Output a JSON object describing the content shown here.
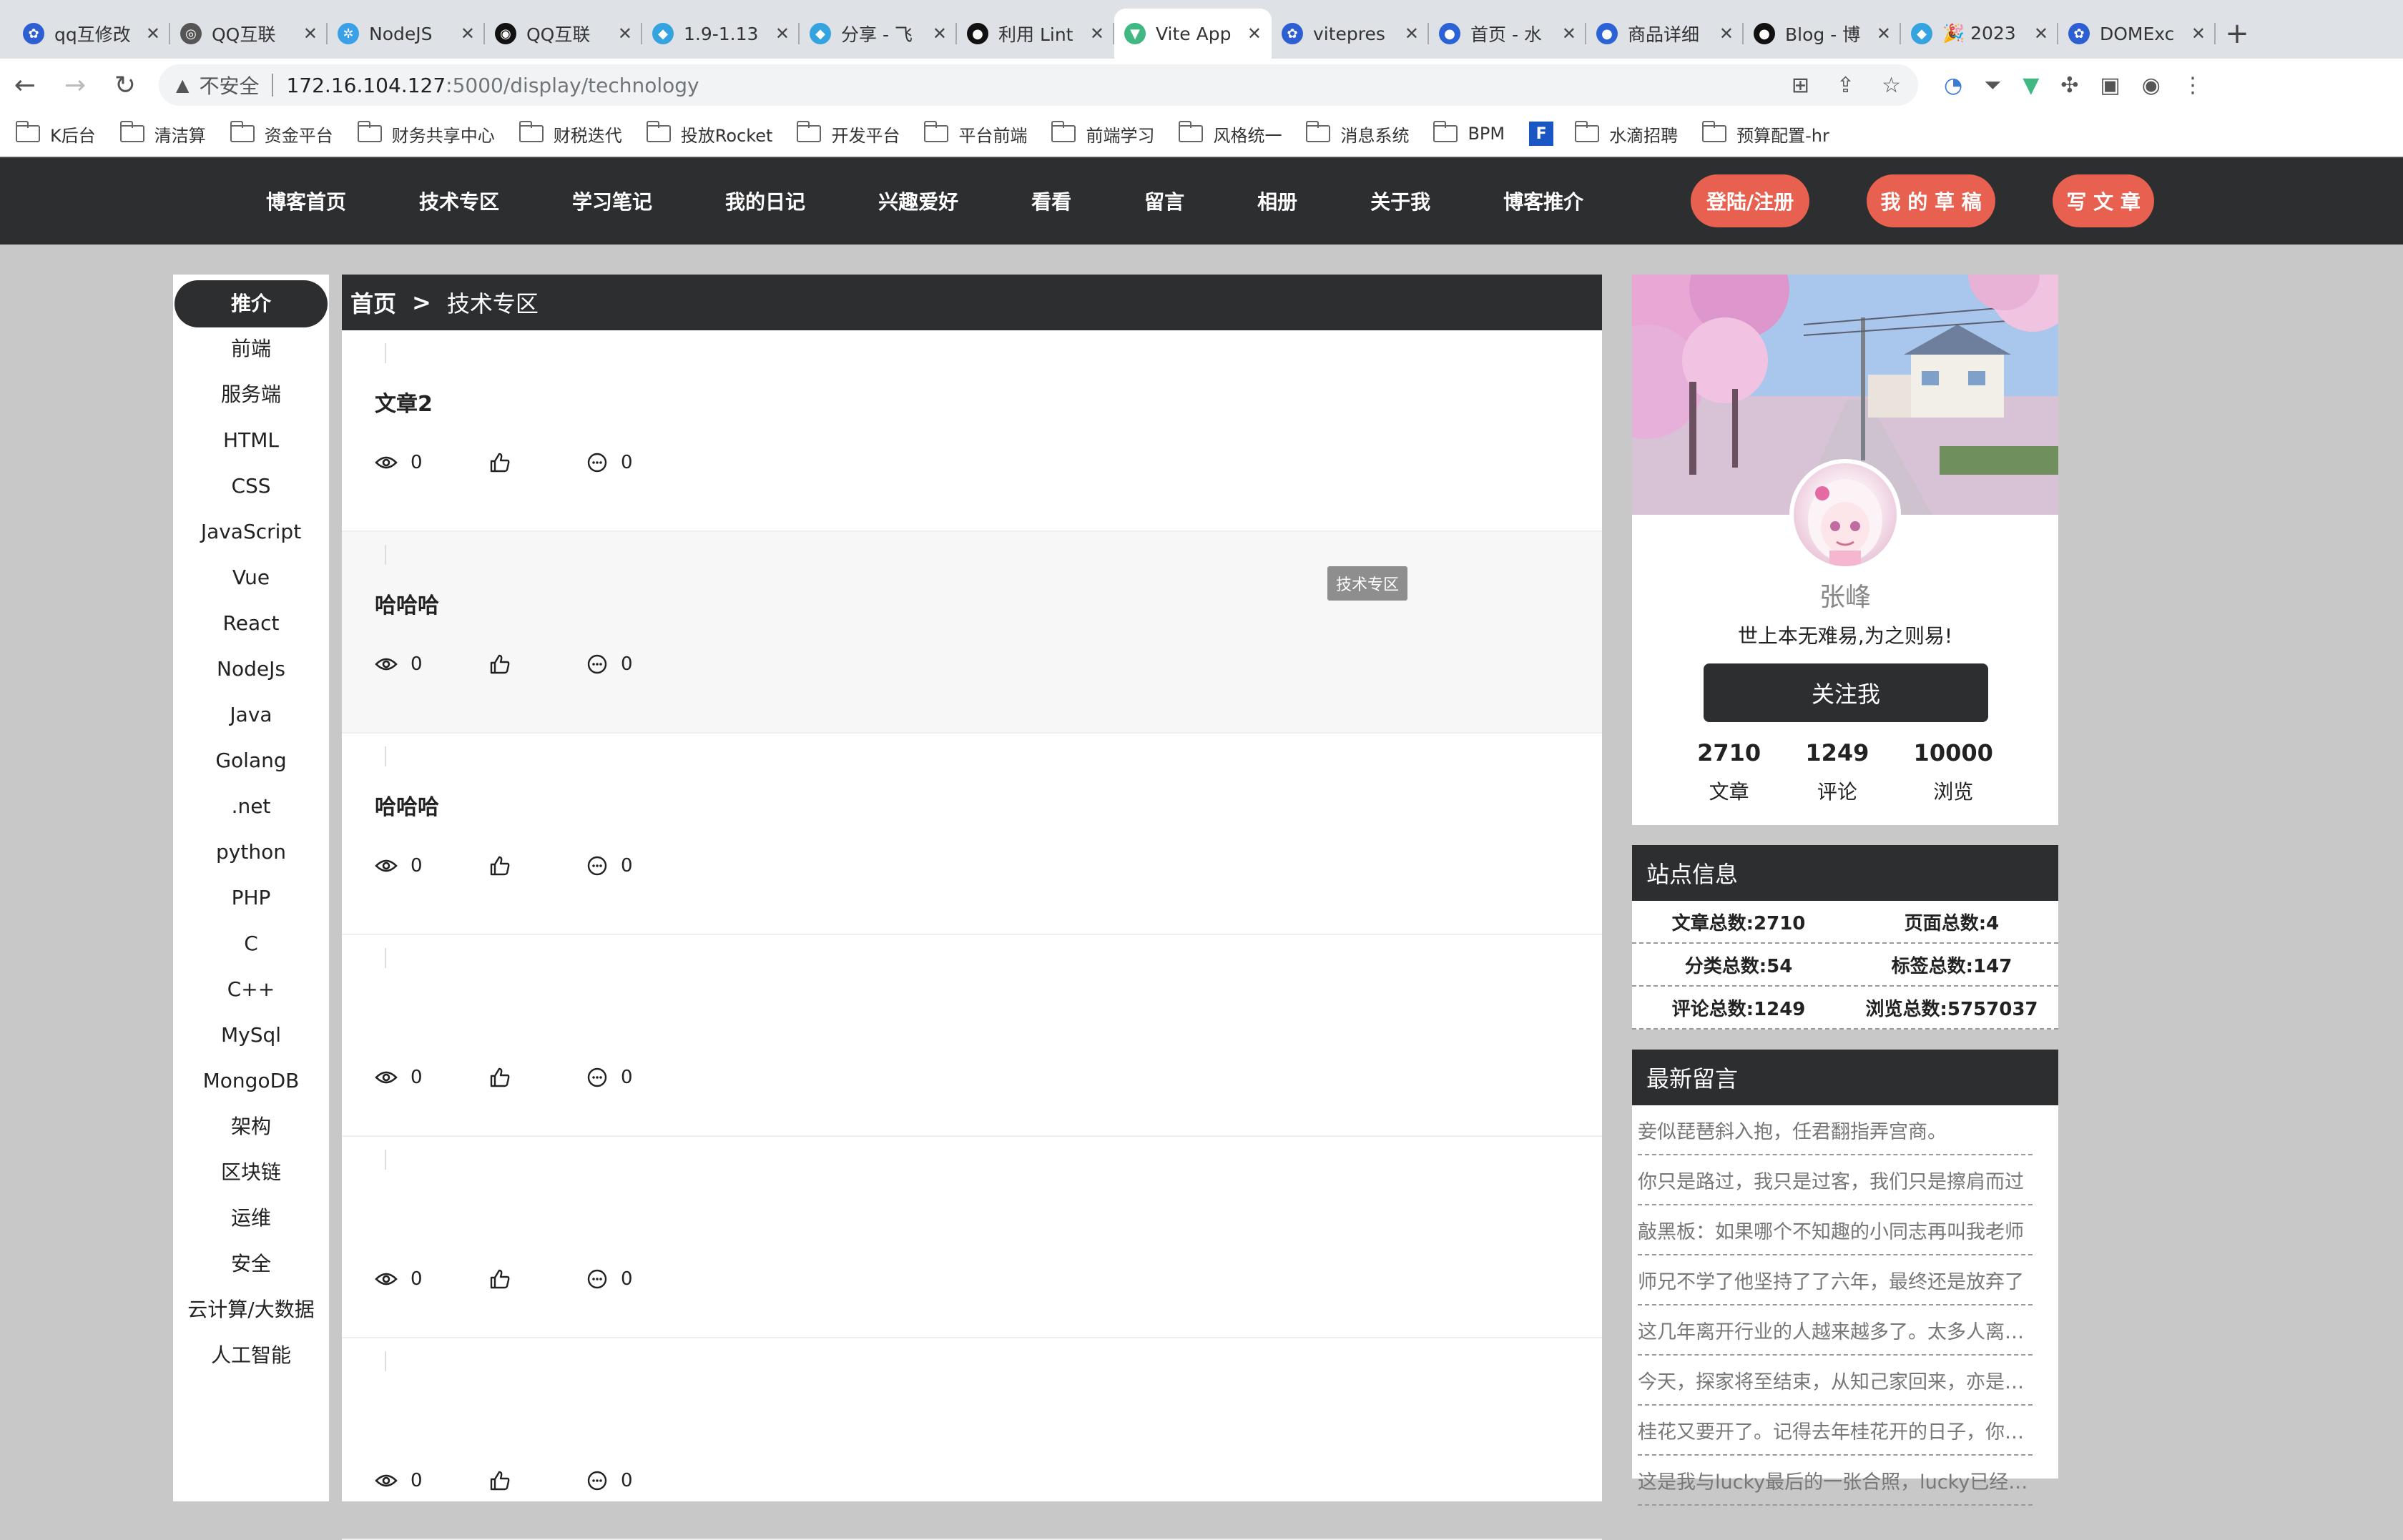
{
  "browser": {
    "tabs": [
      {
        "title": "qq互修改",
        "color": "#2d5fd3",
        "glyph": "✿"
      },
      {
        "title": "QQ互联",
        "color": "#555555",
        "glyph": "◎"
      },
      {
        "title": "NodeJS",
        "color": "#3aa0e8",
        "glyph": "✲"
      },
      {
        "title": "QQ互联",
        "color": "#111111",
        "glyph": "◉"
      },
      {
        "title": "1.9-1.13",
        "color": "#35a3e0",
        "glyph": "◆"
      },
      {
        "title": "分享 - 飞",
        "color": "#35a3e0",
        "glyph": "◆"
      },
      {
        "title": "利用 Lint",
        "color": "#111111",
        "glyph": "●"
      },
      {
        "title": "Vite App",
        "color": "#41b883",
        "glyph": "▼"
      },
      {
        "title": "vitepres",
        "color": "#2d5fd3",
        "glyph": "✿"
      },
      {
        "title": "首页 - 水",
        "color": "#2b63d6",
        "glyph": "●"
      },
      {
        "title": "商品详细",
        "color": "#2b63d6",
        "glyph": "●"
      },
      {
        "title": "Blog - 博",
        "color": "#111111",
        "glyph": "●"
      },
      {
        "title": "🎉 2023",
        "color": "#35a3e0",
        "glyph": "◆"
      },
      {
        "title": "DOMExc",
        "color": "#2d5fd3",
        "glyph": "✿"
      }
    ],
    "active_tab_index": 7,
    "address": {
      "insecure_label": "不安全",
      "host": "172.16.104.127",
      "path": ":5000/display/technology"
    },
    "bookmarks": [
      "K后台",
      "清洁算",
      "资金平台",
      "财务共享中心",
      "财税迭代",
      "投放Rocket",
      "开发平台",
      "平台前端",
      "前端学习",
      "风格统一",
      "消息系统",
      "BPM",
      "F",
      "水滴招聘",
      "预算配置-hr"
    ]
  },
  "nav": {
    "links": [
      "博客首页",
      "技术专区",
      "学习笔记",
      "我的日记",
      "兴趣爱好",
      "看看",
      "留言",
      "相册",
      "关于我",
      "博客推介"
    ],
    "login_label": "登陆/注册",
    "drafts_label": "我 的 草 稿",
    "write_label": "写 文 章",
    "accent": "#e8604f",
    "bar_color": "#2d2e30"
  },
  "sidebar": {
    "categories": [
      "推介",
      "前端",
      "服务端",
      "HTML",
      "CSS",
      "JavaScript",
      "Vue",
      "React",
      "NodeJs",
      "Java",
      "Golang",
      ".net",
      "python",
      "PHP",
      "C",
      "C++",
      "MySql",
      "MongoDB",
      "架构",
      "区块链",
      "运维",
      "安全",
      "云计算/大数据",
      "人工智能"
    ],
    "active_index": 0
  },
  "breadcrumb": {
    "home": "首页",
    "sep": ">",
    "current": "技术专区"
  },
  "articles": [
    {
      "title": "文章2",
      "views": "0",
      "likes": "",
      "comments": "0"
    },
    {
      "title": "哈哈哈",
      "views": "0",
      "likes": "",
      "comments": "0"
    },
    {
      "title": "哈哈哈",
      "views": "0",
      "likes": "",
      "comments": "0"
    },
    {
      "title": "",
      "views": "0",
      "likes": "",
      "comments": "0"
    },
    {
      "title": "",
      "views": "0",
      "likes": "",
      "comments": "0"
    },
    {
      "title": "",
      "views": "0",
      "likes": "",
      "comments": "0"
    }
  ],
  "tooltip": "技术专区",
  "profile": {
    "name": "张峰",
    "motto": "世上本无难易,为之则易!",
    "follow_label": "关注我",
    "counts": [
      {
        "num": "2710",
        "label": "文章"
      },
      {
        "num": "1249",
        "label": "评论"
      },
      {
        "num": "10000",
        "label": "浏览"
      }
    ]
  },
  "site_info": {
    "title": "站点信息",
    "rows": [
      [
        "文章总数:2710",
        "页面总数:4"
      ],
      [
        "分类总数:54",
        "标签总数:147"
      ],
      [
        "评论总数:1249",
        "浏览总数:5757037"
      ]
    ]
  },
  "messages": {
    "title": "最新留言",
    "items": [
      "妾似琵琶斜入抱，任君翻指弄宫商。",
      "你只是路过，我只是过客，我们只是擦肩而过",
      "敲黑板：如果哪个不知趣的小同志再叫我老师",
      "师兄不学了他坚持了了六年，最终还是放弃了",
      "这几年离开行业的人越来越多了。太多人离开了",
      "今天，探家将至结束，从知己家回来，亦是不舍",
      "桂花又要开了。记得去年桂花开的日子，你还在",
      "这是我与lucky最后的一张合照，lucky已经走了"
    ]
  }
}
